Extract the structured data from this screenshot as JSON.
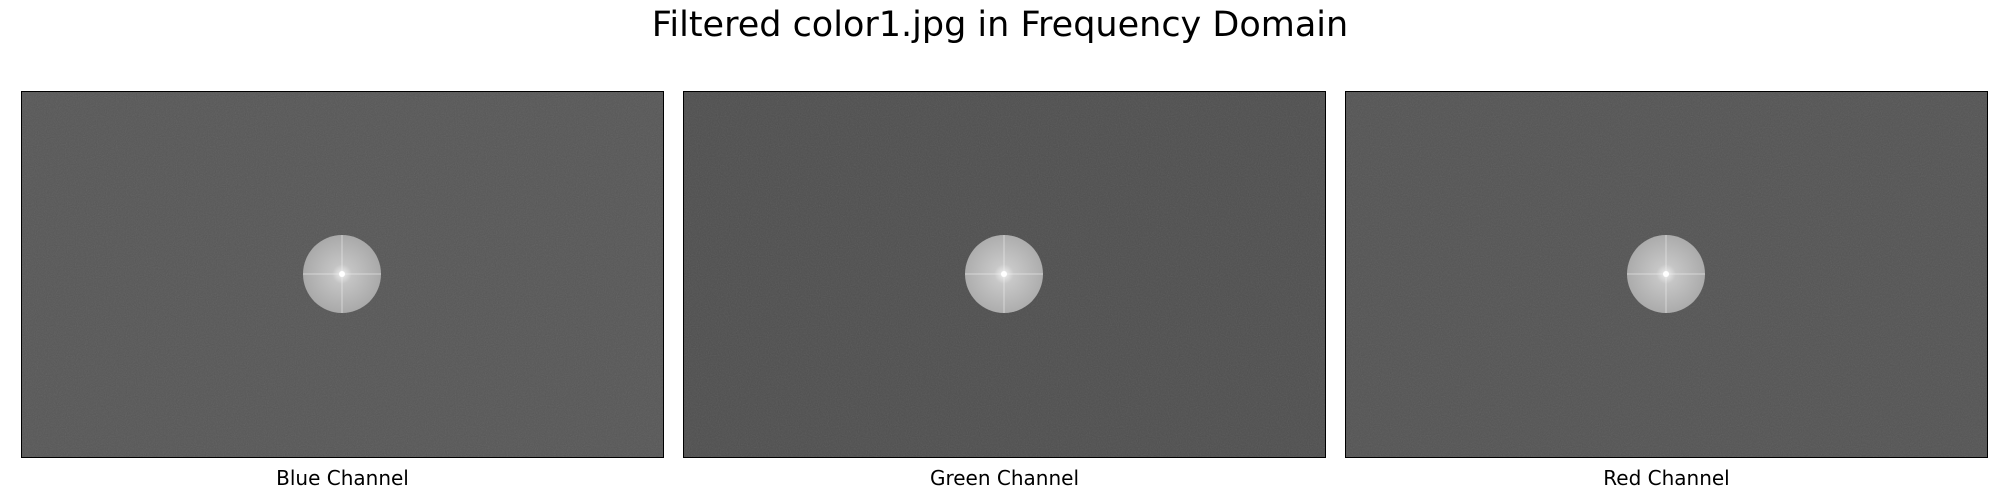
{
  "figure": {
    "title": "Filtered color1.jpg in Frequency Domain"
  },
  "panels": [
    {
      "caption": "Blue Channel",
      "background": "#575757",
      "disc": "#b4b4b4"
    },
    {
      "caption": "Green Channel",
      "background": "#4f4f4f",
      "disc": "#b9b9b9"
    },
    {
      "caption": "Red Channel",
      "background": "#545454",
      "disc": "#b7b7b7"
    }
  ]
}
